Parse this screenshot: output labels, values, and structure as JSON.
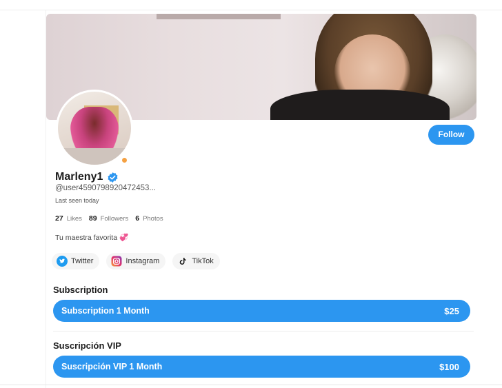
{
  "profile": {
    "name": "Marleny1",
    "handle": "@user4590798920472453...",
    "last_seen": "Last seen today",
    "bio": "Tu maestra favorita 💞",
    "follow_label": "Follow"
  },
  "stats": [
    {
      "value": "27",
      "label": "Likes"
    },
    {
      "value": "89",
      "label": "Followers"
    },
    {
      "value": "6",
      "label": "Photos"
    }
  ],
  "socials": [
    {
      "label": "Twitter",
      "icon": "twitter-icon"
    },
    {
      "label": "Instagram",
      "icon": "instagram-icon"
    },
    {
      "label": "TikTok",
      "icon": "tiktok-icon"
    }
  ],
  "subscription": {
    "title": "Subscription",
    "plan_label": "Subscription 1 Month",
    "price": "$25"
  },
  "vip": {
    "title": "Suscripción VIP",
    "plan_label": "Suscripción VIP 1 Month",
    "price": "$100"
  },
  "colors": {
    "accent": "#2c96f0",
    "online_status": "#f5a142",
    "verified": "#2c96f0"
  }
}
